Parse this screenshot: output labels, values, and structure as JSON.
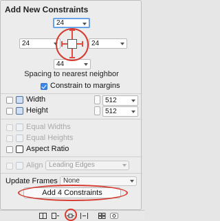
{
  "panel": {
    "title": "Add New Constraints",
    "caption": "Spacing to nearest neighbor",
    "annotation_color": "#d63a2f",
    "accent_color": "#3b86ea"
  },
  "spacing": {
    "top": "24",
    "left": "24",
    "right": "24",
    "bottom": "44"
  },
  "margins": {
    "label": "Constrain to margins",
    "checked": true
  },
  "size": {
    "width_label": "Width",
    "width_value": "512",
    "height_label": "Height",
    "height_value": "512"
  },
  "equal": {
    "widths_label": "Equal Widths",
    "heights_label": "Equal Heights",
    "aspect_label": "Aspect Ratio"
  },
  "align": {
    "label": "Align",
    "value": "Leading Edges"
  },
  "update_frames": {
    "label": "Update Frames",
    "value": "None"
  },
  "add_button": {
    "label": "Add 4 Constraints"
  },
  "toolbar": {
    "icons": [
      "align-icon",
      "pin-icon",
      "resolve-icon",
      "resizing-icon",
      "view-as-icon",
      "status-icon"
    ]
  }
}
